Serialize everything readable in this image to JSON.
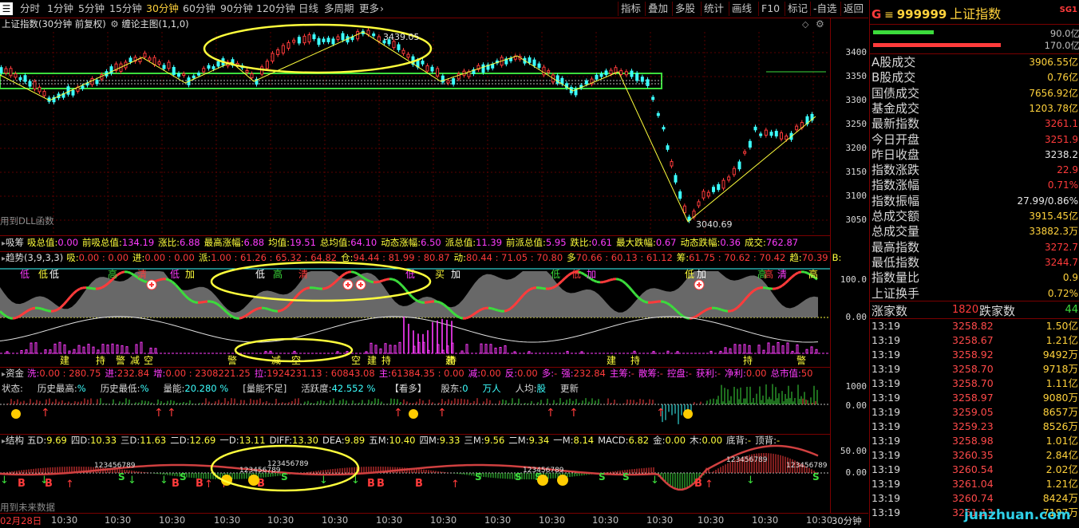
{
  "toolbar": {
    "menu_icon": "menu-icon",
    "periods": [
      "分时",
      "1分钟",
      "5分钟",
      "15分钟",
      "30分钟",
      "60分钟",
      "90分钟",
      "120分钟",
      "日线",
      "多周期",
      "更多"
    ],
    "active_period": "30分钟",
    "functions": [
      "指标",
      "叠加",
      "多股",
      "统计",
      "画线",
      "F10",
      "标记",
      "-自选",
      "返回"
    ]
  },
  "main": {
    "title": "上证指数(30分钟 前复权)",
    "indicator": "缠论主图(1,1,0)",
    "dll_note": "用到DLL函数",
    "high_label": "3439.05",
    "low_label": "3040.69",
    "yticks": [
      "3400",
      "3350",
      "3300",
      "3250",
      "3200",
      "3150",
      "3100",
      "3050"
    ]
  },
  "xichou": {
    "name": "吸筹",
    "items": [
      {
        "k": "吸总值:",
        "v": "0.00"
      },
      {
        "k": "前吸总值:",
        "v": "134.19"
      },
      {
        "k": "涨比:",
        "v": "6.88"
      },
      {
        "k": "最高涨幅:",
        "v": "6.88"
      },
      {
        "k": "均值:",
        "v": "19.51"
      },
      {
        "k": "总均值:",
        "v": "64.10"
      },
      {
        "k": "动态涨幅:",
        "v": "6.50"
      },
      {
        "k": "派总值:",
        "v": "11.39"
      },
      {
        "k": "前派总值:",
        "v": "5.95"
      },
      {
        "k": "跌比:",
        "v": "0.61"
      },
      {
        "k": "最大跌幅:",
        "v": "0.67"
      },
      {
        "k": "动态跌幅:",
        "v": "0.36"
      },
      {
        "k": "成交:",
        "v": "762.87"
      }
    ]
  },
  "trend": {
    "title": "趋势(3,9,3,3)",
    "items": [
      {
        "k": "吸:",
        "v": "0.00 : 0.00"
      },
      {
        "k": "进:",
        "v": "0.00 : 0.00"
      },
      {
        "k": "派:",
        "v": "1.00 : 61.26 : 65.32 : 64.82"
      },
      {
        "k": "仓:",
        "v": "94.44 : 81.99 : 80.87"
      },
      {
        "k": "动:",
        "v": "80.44 : 71.05 : 70.80"
      },
      {
        "k": "多",
        "v": "70.66 : 60.13 : 61.12"
      },
      {
        "k": "筹:",
        "v": "61.75 : 70.62 : 70.42"
      },
      {
        "k": "趋:",
        "v": "70.39"
      },
      {
        "k": "B:",
        "v": ""
      }
    ],
    "yticks": [
      "100.0",
      "0.00"
    ],
    "signals_top": [
      "低",
      "低",
      "低",
      "高",
      "清",
      "低",
      "加",
      "低",
      "高",
      "清",
      "低",
      "买",
      "加",
      "低",
      "低",
      "加",
      "低",
      "加",
      "高",
      "高",
      "清",
      "高"
    ],
    "signals_bottom": [
      "建",
      "持",
      "警",
      "减",
      "空",
      "警",
      "减",
      "空",
      "建",
      "持",
      "建",
      "持",
      "空",
      "建",
      "持",
      "持",
      "警"
    ]
  },
  "fund": {
    "title": "资金",
    "items": [
      {
        "k": "洗:",
        "v": "0.00 : 280.75"
      },
      {
        "k": "进:",
        "v": "232.84"
      },
      {
        "k": "增:",
        "v": "0.00 : 2308221.25"
      },
      {
        "k": "拉:",
        "v": "1924231.13 : 60843.08"
      },
      {
        "k": "主:",
        "v": "61384.35 : 0.00"
      },
      {
        "k": "减:",
        "v": "0.00"
      },
      {
        "k": "反:",
        "v": "0.00"
      },
      {
        "k": "多:",
        "v": "-"
      },
      {
        "k": "强:",
        "v": "232.84"
      },
      {
        "k": "主筹:",
        "v": "-"
      },
      {
        "k": "散筹:",
        "v": "-"
      },
      {
        "k": "控盘:",
        "v": "-"
      },
      {
        "k": "获利:",
        "v": "-"
      },
      {
        "k": "净利:",
        "v": "0.00"
      },
      {
        "k": "总市值:",
        "v": "50"
      }
    ],
    "row2": [
      {
        "k": "状态:",
        "v": ""
      },
      {
        "k": "历史最高:",
        "v": "%"
      },
      {
        "k": "历史最低:",
        "v": "%"
      },
      {
        "k": "量能:",
        "v": "20.280 %"
      },
      {
        "k": "[量能不足]",
        "v": ""
      },
      {
        "k": "活跃度:",
        "v": "42.552 %"
      },
      {
        "k": "【看多】",
        "v": ""
      },
      {
        "k": "股东:",
        "v": "0"
      },
      {
        "k": "",
        "v": "万人"
      },
      {
        "k": "人均:",
        "v": "股"
      },
      {
        "k": "更新",
        "v": ""
      }
    ],
    "yticks": [
      "1000",
      "0.00"
    ]
  },
  "structure": {
    "title": "结构",
    "items": [
      {
        "k": "五D:",
        "v": "9.69"
      },
      {
        "k": "四D:",
        "v": "10.33"
      },
      {
        "k": "三D:",
        "v": "11.63"
      },
      {
        "k": "二D:",
        "v": "12.69"
      },
      {
        "k": "一D:",
        "v": "13.11"
      },
      {
        "k": "DIFF:",
        "v": "13.30"
      },
      {
        "k": "DEA:",
        "v": "9.89"
      },
      {
        "k": "五M:",
        "v": "10.40"
      },
      {
        "k": "四M:",
        "v": "9.33"
      },
      {
        "k": "三M:",
        "v": "9.56"
      },
      {
        "k": "二M:",
        "v": "9.34"
      },
      {
        "k": "一M:",
        "v": "8.14"
      },
      {
        "k": "MACD:",
        "v": "6.82"
      },
      {
        "k": "金:",
        "v": "0.00"
      },
      {
        "k": "木:",
        "v": "0.00"
      },
      {
        "k": "底背:",
        "v": "-"
      },
      {
        "k": "顶背:",
        "v": "-"
      }
    ],
    "future_note": "用到未来数据",
    "yticks": [
      "50.00",
      "0.00"
    ],
    "seq_label": "123456789"
  },
  "xaxis": {
    "labels": [
      "02月28日",
      "10:30",
      "10:30",
      "10:30",
      "10:30",
      "10:30",
      "10:30",
      "10:30",
      "10:30",
      "10:30",
      "10:30",
      "10:30",
      "10:30",
      "10:30",
      "10:30",
      "10:30"
    ],
    "period": "30分钟"
  },
  "quote": {
    "prefix": "G",
    "code": "999999",
    "name": "上证指数",
    "badge": "SG1",
    "bar_vals": [
      "90.0亿",
      "170.0亿"
    ],
    "rows": [
      {
        "k": "A股成交",
        "v": "3906.55亿"
      },
      {
        "k": "B股成交",
        "v": "0.76亿"
      },
      {
        "k": "国债成交",
        "v": "7656.92亿"
      },
      {
        "k": "基金成交",
        "v": "1203.78亿"
      },
      {
        "k": "最新指数",
        "v": "3261.1"
      },
      {
        "k": "今日开盘",
        "v": "3251.9"
      },
      {
        "k": "昨日收盘",
        "v": "3238.2"
      },
      {
        "k": "指数涨跌",
        "v": "22.9"
      },
      {
        "k": "指数涨幅",
        "v": "0.71%"
      },
      {
        "k": "指数振幅",
        "v": "27.99/0.86%"
      },
      {
        "k": "总成交额",
        "v": "3915.45亿"
      },
      {
        "k": "总成交量",
        "v": "33882.3万"
      },
      {
        "k": "最高指数",
        "v": "3272.7"
      },
      {
        "k": "最低指数",
        "v": "3244.7"
      },
      {
        "k": "指数量比",
        "v": "0.9"
      },
      {
        "k": "上证换手",
        "v": "0.72%"
      }
    ],
    "up_label": "涨家数",
    "up_count": "1820",
    "down_label": "跌家数",
    "down_count": "44",
    "ticks": [
      {
        "t": "13:19",
        "p": "3258.82",
        "v": "1.50亿"
      },
      {
        "t": "13:19",
        "p": "3258.67",
        "v": "1.21亿"
      },
      {
        "t": "13:19",
        "p": "3258.92",
        "v": "9492万"
      },
      {
        "t": "13:19",
        "p": "3258.70",
        "v": "9718万"
      },
      {
        "t": "13:19",
        "p": "3258.70",
        "v": "1.11亿"
      },
      {
        "t": "13:19",
        "p": "3258.97",
        "v": "9080万"
      },
      {
        "t": "13:19",
        "p": "3259.05",
        "v": "8657万"
      },
      {
        "t": "13:19",
        "p": "3259.23",
        "v": "8526万"
      },
      {
        "t": "13:19",
        "p": "3258.98",
        "v": "1.01亿"
      },
      {
        "t": "13:19",
        "p": "3260.35",
        "v": "2.84亿"
      },
      {
        "t": "13:19",
        "p": "3260.54",
        "v": "2.02亿"
      },
      {
        "t": "13:19",
        "p": "3261.04",
        "v": "1.21亿"
      },
      {
        "t": "13:19",
        "p": "3260.74",
        "v": "8424万"
      },
      {
        "t": "13:19",
        "p": "3261.13",
        "v": "7197万"
      }
    ],
    "watermark": "junzhuan.com"
  },
  "colors": {
    "red": "#ff3b3b",
    "green": "#3cdc3c",
    "yellow": "#ffff3c",
    "cyan": "#3cffff",
    "magenta": "#ff3cff",
    "gray": "#8c8c8c"
  }
}
